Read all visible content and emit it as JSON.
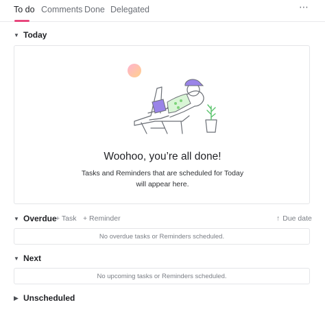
{
  "tabs": [
    {
      "label": "To do"
    },
    {
      "label": "Comments"
    },
    {
      "label": "Done"
    },
    {
      "label": "Delegated"
    }
  ],
  "more_icon": "⋯",
  "accent_color": "#e8467c",
  "today": {
    "title": "Today",
    "empty_title": "Woohoo, you’re all done!",
    "empty_text": "Tasks and Reminders that are scheduled for Today will appear here."
  },
  "overdue": {
    "title": "Overdue",
    "add_task": "+ Task",
    "add_reminder": "+ Reminder",
    "sort_label": "Due date",
    "empty_text": "No overdue tasks or Reminders scheduled."
  },
  "next": {
    "title": "Next",
    "empty_text": "No upcoming tasks or Reminders scheduled."
  },
  "unscheduled": {
    "title": "Unscheduled"
  }
}
